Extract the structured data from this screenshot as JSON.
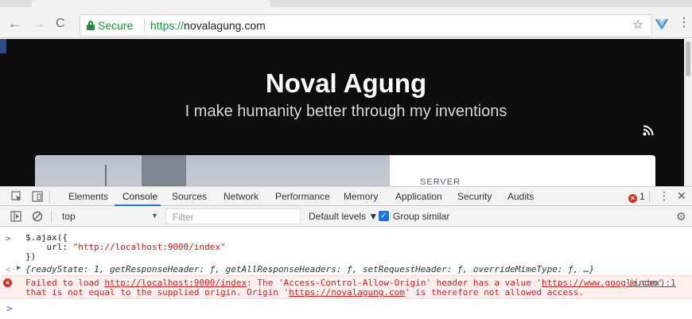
{
  "browser": {
    "secure_label": "Secure",
    "url_scheme": "https://",
    "url_host": "novalagung.com"
  },
  "page": {
    "title": "Noval Agung",
    "subtitle": "I make humanity better through my inventions",
    "card_label": "SERVER"
  },
  "devtools": {
    "tabs": [
      "Elements",
      "Console",
      "Sources",
      "Network",
      "Performance",
      "Memory",
      "Application",
      "Security",
      "Audits"
    ],
    "active_tab": "Console",
    "error_count": "1",
    "context": "top",
    "filter_placeholder": "Filter",
    "levels_label": "Default levels ▼",
    "group_similar_label": "Group similar",
    "group_similar_checked": true
  },
  "console": {
    "input_line1": "$.ajax({",
    "input_line2_key": "    url: ",
    "input_line2_value": "\"http://localhost:9000/index\"",
    "input_line3": "})",
    "result": "{readyState: 1, getResponseHeader: ƒ, getAllResponseHeaders: ƒ, setRequestHeader: ƒ, overrideMimeType: ƒ, …}",
    "error_prefix": "Failed to load ",
    "error_url": "http://localhost:9000/index",
    "error_mid": ": The 'Access-Control-Allow-Origin' header has a value '",
    "error_origin_value": "https://www.google.com",
    "error_mid_end": "'",
    "error_source": "(index):1",
    "error_line2_prefix": "that is not equal to the supplied origin. Origin '",
    "error_line2_origin": "https://novalagung.com",
    "error_line2_suffix": "' is therefore not allowed access."
  },
  "colors": {
    "secure_green": "#1e8e3e",
    "error_red": "#d61b1b",
    "devtools_blue": "#1a73e8"
  }
}
